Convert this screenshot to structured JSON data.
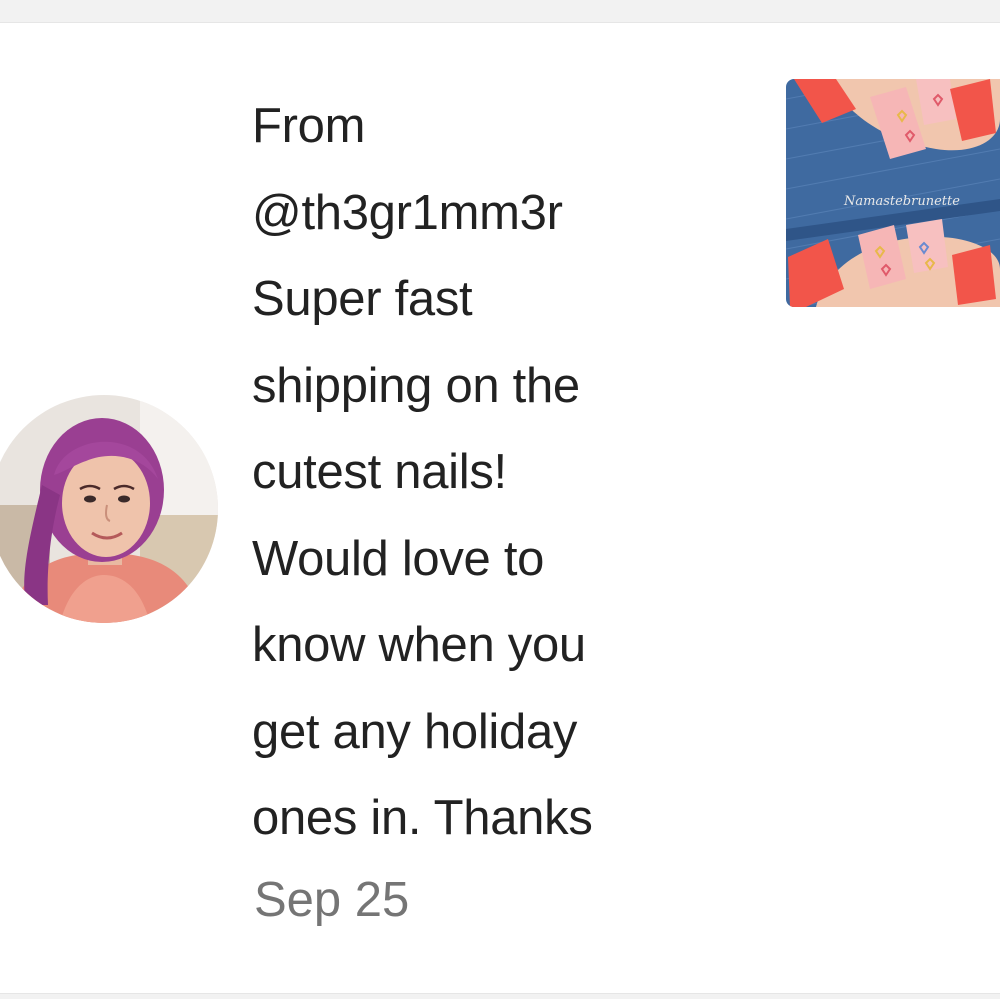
{
  "notification": {
    "from_label": "From",
    "sender_handle": "@th3gr1mm3r",
    "message_lines": [
      "Super fast",
      "shipping on the",
      "cutest nails!",
      "Would love to",
      "know when you",
      "get any holiday",
      "ones in. Thanks"
    ],
    "date": "Sep 25"
  },
  "thumbnail": {
    "watermark": "Namastebrunette"
  },
  "colors": {
    "text_primary": "#222222",
    "text_secondary": "#757575",
    "nail_red": "#f2554a",
    "denim": "#3f6aa0"
  }
}
